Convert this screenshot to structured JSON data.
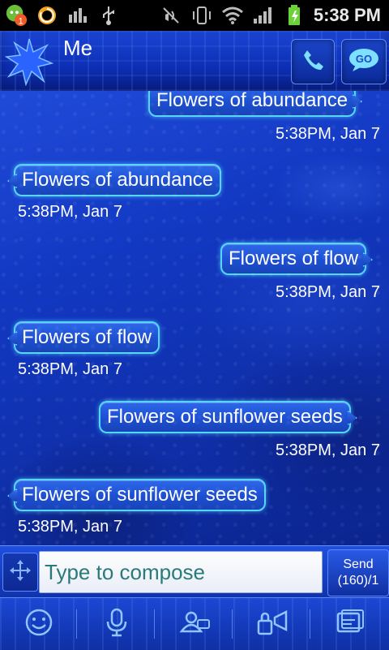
{
  "status_bar": {
    "time": "5:38 PM",
    "notification_count": "1",
    "icons": [
      "messaging-notification-icon",
      "sync-icon",
      "signal-bars-app-icon",
      "usb-icon",
      "vibrate-icon",
      "mute-icon",
      "wifi-icon",
      "cell-signal-icon",
      "battery-charging-icon"
    ]
  },
  "header": {
    "title": "Me",
    "buttons": [
      {
        "name": "call",
        "icon": "phone-icon"
      },
      {
        "name": "go",
        "label": "GO",
        "icon": "go-chat-icon"
      }
    ]
  },
  "conversation": {
    "messages": [
      {
        "direction": "out",
        "text": "Flowers of abundance",
        "time": "5:38PM, Jan 7"
      },
      {
        "direction": "in",
        "text": "Flowers of abundance",
        "time": "5:38PM, Jan 7"
      },
      {
        "direction": "out",
        "text": "Flowers of flow",
        "time": "5:38PM, Jan 7"
      },
      {
        "direction": "in",
        "text": "Flowers of flow",
        "time": "5:38PM, Jan 7"
      },
      {
        "direction": "out",
        "text": "Flowers of sunflower seeds",
        "time": "5:38PM, Jan 7"
      },
      {
        "direction": "in",
        "text": "Flowers of sunflower seeds",
        "time": "5:38PM, Jan 7"
      }
    ]
  },
  "compose": {
    "placeholder": "Type to compose",
    "send_label": "Send",
    "char_count": "(160)/1"
  },
  "toolbar": {
    "items": [
      "emoji-icon",
      "microphone-icon",
      "contact-card-icon",
      "lock-megaphone-icon",
      "templates-icon"
    ]
  },
  "colors": {
    "accent": "#55d5ff",
    "bubble": "#1d4fd1",
    "background": "#1238c2"
  }
}
